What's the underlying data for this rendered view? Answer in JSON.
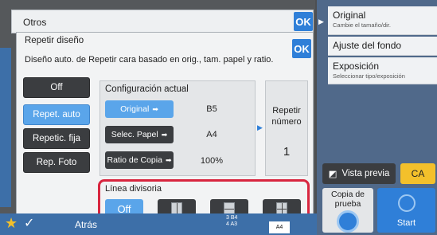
{
  "outer_popup": {
    "title": "Otros",
    "ok_label": "OK"
  },
  "inner_popup": {
    "title": "Repetir diseño",
    "ok_label": "OK",
    "description": "Diseño auto. de Repetir cara basado en orig., tam. papel y ratio.",
    "modes": [
      {
        "label": "Off",
        "selected": false
      },
      {
        "label": "Repet. auto",
        "selected": true
      },
      {
        "label": "Repetic. fija",
        "selected": false
      },
      {
        "label": "Rep. Foto",
        "selected": false
      }
    ],
    "config": {
      "title": "Configuración actual",
      "rows": [
        {
          "button": "Original",
          "value": "B5"
        },
        {
          "button": "Selec. Papel",
          "value": "A4"
        },
        {
          "button": "Ratio de Copia",
          "value": "100%"
        }
      ]
    },
    "repeat": {
      "label_line1": "Repetir",
      "label_line2": "número",
      "value": "1"
    },
    "divider": {
      "label": "Línea divisoria",
      "off_label": "Off"
    }
  },
  "right_panel": {
    "items": [
      {
        "title": "Original",
        "sub": "Cambie el tamaño/dir."
      },
      {
        "title": "Ajuste del fondo",
        "sub": ""
      },
      {
        "title": "Exposición",
        "sub": "Seleccionar tipo/exposición"
      }
    ],
    "vista_previa": "Vista previa",
    "ca": "CA",
    "copia_line1": "Copia de",
    "copia_line2": "prueba",
    "start": "Start"
  },
  "bottom_bar": {
    "back_label": "Atrás",
    "tray_line1": "3  B4",
    "tray_line2": "4  A3",
    "paper": "A4"
  },
  "colors": {
    "accent": "#2f7fd8",
    "selected": "#5aa5ea",
    "highlight": "#d8263f",
    "ca": "#f3c02b"
  }
}
